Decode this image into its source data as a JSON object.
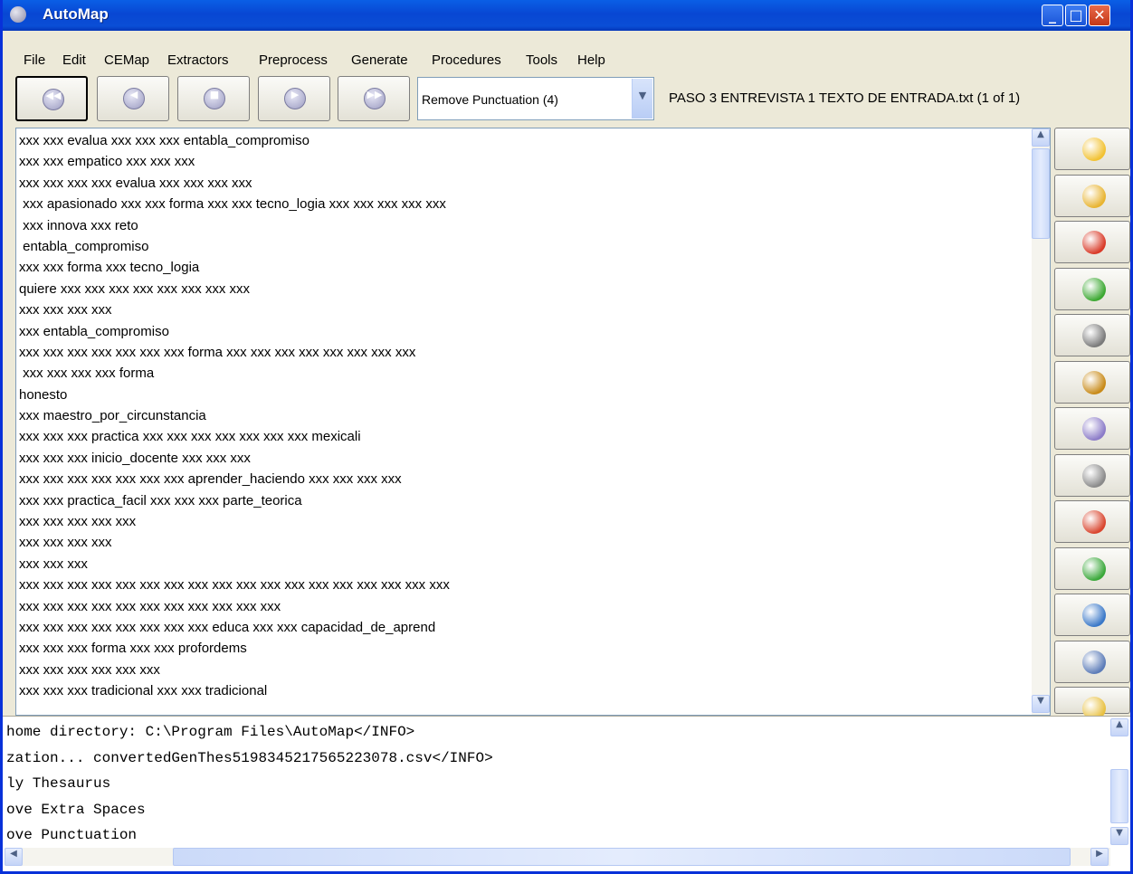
{
  "window": {
    "title": "AutoMap"
  },
  "menu": [
    "File",
    "Edit",
    "CEMap",
    "Extractors",
    "Preprocess",
    "Generate",
    "Procedures",
    "Tools",
    "Help"
  ],
  "toolbar": {
    "nav_buttons": [
      "first-icon",
      "previous-icon",
      "stop-icon",
      "next-icon",
      "last-icon"
    ],
    "procedure_select": "Remove Punctuation (4)",
    "file_info": "PASO 3 ENTREVISTA 1 TEXTO DE ENTRADA.txt   (1 of 1)"
  },
  "text_lines": [
    "xxx xxx evalua xxx xxx xxx entabla_compromiso",
    "xxx xxx empatico xxx xxx xxx",
    "xxx xxx xxx xxx evalua xxx xxx xxx xxx",
    " xxx apasionado xxx xxx forma xxx xxx tecno_logia xxx xxx xxx xxx xxx",
    " xxx innova xxx reto",
    " entabla_compromiso",
    "xxx xxx forma xxx tecno_logia",
    "quiere xxx xxx xxx xxx xxx xxx xxx xxx",
    "xxx xxx xxx xxx",
    "xxx entabla_compromiso",
    "xxx xxx xxx xxx xxx xxx xxx forma xxx xxx xxx xxx xxx xxx xxx xxx",
    " xxx xxx xxx xxx forma",
    "honesto",
    "xxx maestro_por_circunstancia",
    "xxx xxx xxx practica xxx xxx xxx xxx xxx xxx xxx mexicali",
    "xxx xxx xxx inicio_docente xxx xxx xxx",
    "xxx xxx xxx xxx xxx xxx xxx aprender_haciendo xxx xxx xxx xxx",
    "xxx xxx practica_facil xxx xxx xxx parte_teorica",
    "xxx xxx xxx xxx xxx",
    "xxx xxx xxx xxx",
    "xxx xxx xxx",
    "xxx xxx xxx xxx xxx xxx xxx xxx xxx xxx xxx xxx xxx xxx xxx xxx xxx xxx",
    "xxx xxx xxx xxx xxx xxx xxx xxx xxx xxx xxx",
    "xxx xxx xxx xxx xxx xxx xxx xxx educa xxx xxx capacidad_de_aprend",
    "xxx xxx xxx forma xxx xxx profordems",
    "xxx xxx xxx xxx xxx xxx",
    "xxx xxx xxx tradicional xxx xxx tradicional"
  ],
  "tool_buttons": [
    "open-folder-icon",
    "open-directory-icon",
    "delete-icon",
    "run-icon",
    "stamp-icon",
    "chart-icon",
    "network-icon",
    "disk-icon",
    "remove-edit-icon",
    "apply-edit-icon",
    "search-icon",
    "thesaurus-icon",
    "warning-icon"
  ],
  "tool_colors": [
    "#f2c233",
    "#e8b431",
    "#d93a28",
    "#3ca832",
    "#7a7a7a",
    "#c88a18",
    "#8c7cc8",
    "#8a8a8a",
    "#d9452e",
    "#3aa83a",
    "#3a78c8",
    "#5c7cb8",
    "#e8c040"
  ],
  "log_lines": [
    "home directory: C:\\Program Files\\AutoMap</INFO>",
    "zation... convertedGenThes5198345217565223078.csv</INFO>",
    "ly Thesaurus",
    "ove Extra Spaces",
    "ove Punctuation"
  ]
}
